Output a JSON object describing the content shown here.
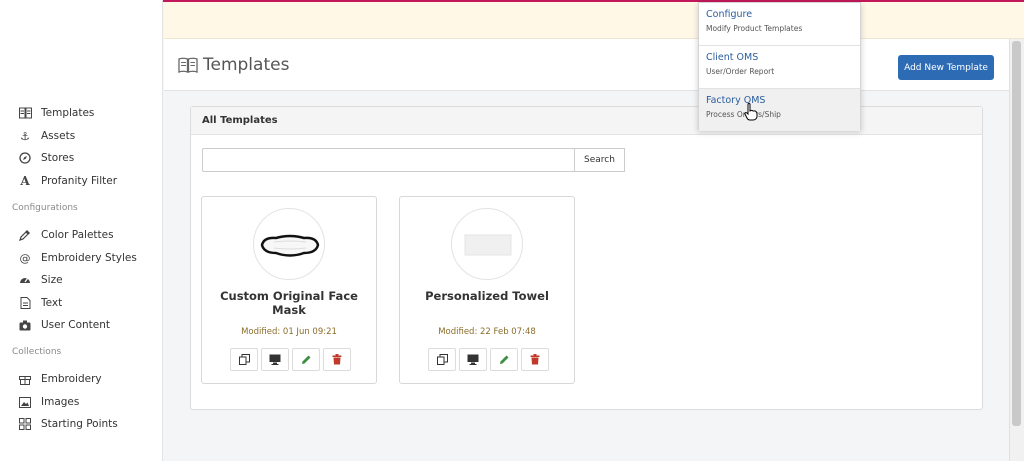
{
  "sidebar": {
    "items_top": [
      {
        "label": "Templates",
        "icon": "book-icon"
      },
      {
        "label": "Assets",
        "icon": "anchor-icon"
      },
      {
        "label": "Stores",
        "icon": "compass-icon"
      },
      {
        "label": "Profanity Filter",
        "icon": "font-a-icon"
      }
    ],
    "section_configurations": "Configurations",
    "items_config": [
      {
        "label": "Color Palettes",
        "icon": "eyedropper-icon"
      },
      {
        "label": "Embroidery Styles",
        "icon": "at-icon"
      },
      {
        "label": "Size",
        "icon": "tachometer-icon"
      },
      {
        "label": "Text",
        "icon": "file-text-icon"
      },
      {
        "label": "User Content",
        "icon": "camera-icon"
      }
    ],
    "section_collections": "Collections",
    "items_collections": [
      {
        "label": "Embroidery",
        "icon": "gift-icon"
      },
      {
        "label": "Images",
        "icon": "image-icon"
      },
      {
        "label": "Starting Points",
        "icon": "grid-icon"
      }
    ]
  },
  "header": {
    "title": "Templates",
    "add_button": "Add New Template"
  },
  "panel": {
    "title": "All Templates",
    "search_value": "",
    "search_button": "Search"
  },
  "templates": [
    {
      "title": "Custom Original Face Mask",
      "modified": "Modified: 01 Jun 09:21"
    },
    {
      "title": "Personalized Towel",
      "modified": "Modified: 22 Feb 07:48"
    }
  ],
  "dropdown": {
    "items": [
      {
        "title": "Configure",
        "subtitle": "Modify Product Templates"
      },
      {
        "title": "Client OMS",
        "subtitle": "User/Order Report"
      },
      {
        "title": "Factory OMS",
        "subtitle": "Process Orders/Ship"
      }
    ]
  },
  "colors": {
    "accent": "#2d6cb5",
    "topline": "#c2185b",
    "banner": "#fff8e6",
    "modified_text": "#8b6d2a",
    "delete_icon": "#c0392b",
    "edit_icon": "#3e8e41"
  }
}
